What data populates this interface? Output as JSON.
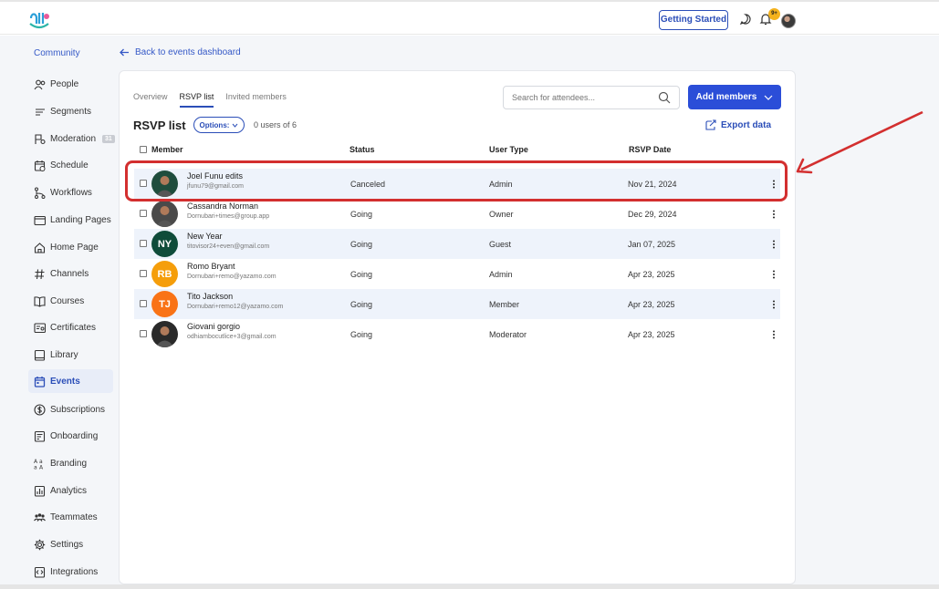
{
  "topbar": {
    "getting_started": "Getting Started",
    "notification_count": "9+"
  },
  "sidebar": {
    "section_label": "Community",
    "items": [
      {
        "label": "People",
        "icon": "people-icon"
      },
      {
        "label": "Segments",
        "icon": "segments-icon"
      },
      {
        "label": "Moderation",
        "icon": "moderation-icon",
        "badge": "31"
      },
      {
        "label": "Schedule",
        "icon": "schedule-icon"
      },
      {
        "label": "Workflows",
        "icon": "workflows-icon"
      },
      {
        "label": "Landing Pages",
        "icon": "landing-pages-icon"
      },
      {
        "label": "Home Page",
        "icon": "home-icon"
      },
      {
        "label": "Channels",
        "icon": "hash-icon"
      },
      {
        "label": "Courses",
        "icon": "book-icon"
      },
      {
        "label": "Certificates",
        "icon": "certificate-icon"
      },
      {
        "label": "Library",
        "icon": "library-icon"
      },
      {
        "label": "Events",
        "icon": "calendar-icon",
        "active": true
      },
      {
        "label": "Subscriptions",
        "icon": "dollar-icon"
      },
      {
        "label": "Onboarding",
        "icon": "onboarding-icon"
      },
      {
        "label": "Branding",
        "icon": "branding-icon"
      },
      {
        "label": "Analytics",
        "icon": "analytics-icon"
      },
      {
        "label": "Teammates",
        "icon": "teammates-icon"
      },
      {
        "label": "Settings",
        "icon": "gear-icon"
      },
      {
        "label": "Integrations",
        "icon": "integrations-icon"
      }
    ]
  },
  "back_link": "Back to events dashboard",
  "tabs": [
    {
      "label": "Overview",
      "active": false
    },
    {
      "label": "RSVP list",
      "active": true
    },
    {
      "label": "Invited members",
      "active": false
    }
  ],
  "search": {
    "placeholder": "Search for attendees..."
  },
  "add_members_label": "Add members",
  "list": {
    "title": "RSVP list",
    "options_label": "Options:",
    "count": "0 users of 6",
    "export_label": "Export data"
  },
  "table": {
    "headers": {
      "member": "Member",
      "status": "Status",
      "user_type": "User Type",
      "rsvp_date": "RSVP Date"
    },
    "rows": [
      {
        "name": "Joel Funu edits",
        "email": "jfunu79@gmail.com",
        "status": "Canceled",
        "user_type": "Admin",
        "date": "Nov 21, 2024",
        "avatar": "photo",
        "avatar_color": "#1f4d3d"
      },
      {
        "name": "Cassandra Norman",
        "email": "Dornubari+times@group.app",
        "status": "Going",
        "user_type": "Owner",
        "date": "Dec 29, 2024",
        "avatar": "photo",
        "avatar_color": "#4a4a4a"
      },
      {
        "name": "New Year",
        "email": "titovisor24+even@gmail.com",
        "status": "Going",
        "user_type": "Guest",
        "date": "Jan 07, 2025",
        "avatar": "NY",
        "avatar_color": "#0f4c3a"
      },
      {
        "name": "Romo Bryant",
        "email": "Dornubari+remo@yazamo.com",
        "status": "Going",
        "user_type": "Admin",
        "date": "Apr 23, 2025",
        "avatar": "RB",
        "avatar_color": "#f59e0b"
      },
      {
        "name": "Tito Jackson",
        "email": "Dornubari+remo12@yazamo.com",
        "status": "Going",
        "user_type": "Member",
        "date": "Apr 23, 2025",
        "avatar": "TJ",
        "avatar_color": "#f97316"
      },
      {
        "name": "Giovani gorgio",
        "email": "odhiambocutlice+3@gmail.com",
        "status": "Going",
        "user_type": "Moderator",
        "date": "Apr 23, 2025",
        "avatar": "photo",
        "avatar_color": "#2a2a2a"
      }
    ]
  },
  "colors": {
    "accent": "#2b4ed8",
    "highlight": "#d32f2f",
    "row_shade": "#eef3fb"
  }
}
